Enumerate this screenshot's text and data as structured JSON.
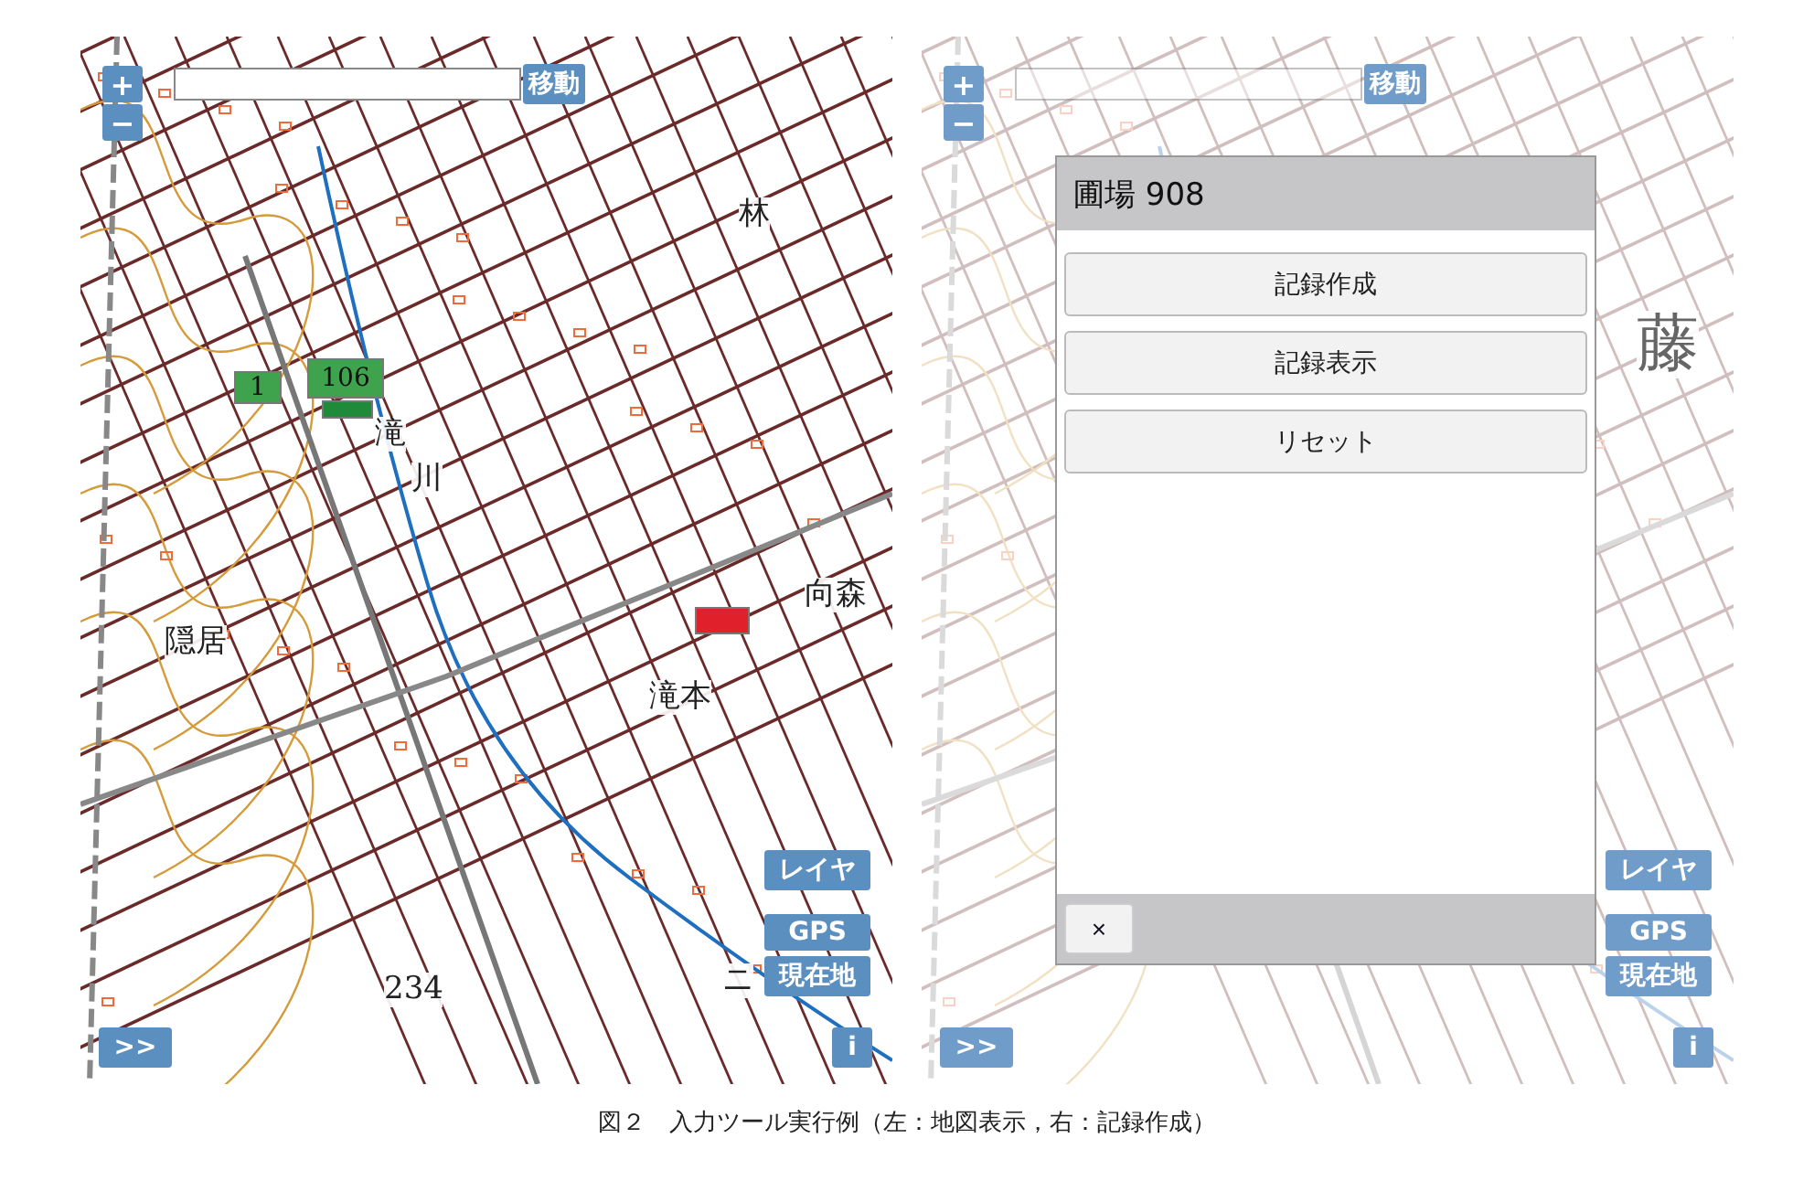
{
  "panels": [
    {
      "kind": "map",
      "faded": false,
      "zoom_in": "+",
      "zoom_out": "−",
      "move_button": "移動",
      "labels": [
        "林",
        "滝",
        "川",
        "隠居",
        "滝本",
        "向森",
        "234",
        "ニ"
      ],
      "parcels": [
        {
          "label": "1",
          "color": "#3fa34d"
        },
        {
          "label": "106",
          "color": "#3fa34d"
        },
        {
          "color": "#1f8a3a"
        },
        {
          "color": "#e0202a"
        }
      ],
      "layer_button": "レイヤ",
      "gps_button": "GPS",
      "location_button": "現在地",
      "expand_button": ">>",
      "info_button": "i"
    },
    {
      "kind": "map",
      "faded": true,
      "zoom_in": "+",
      "zoom_out": "−",
      "move_button": "移動",
      "labels": [
        "藤"
      ],
      "layer_button": "レイヤ",
      "gps_button": "GPS",
      "location_button": "現在地",
      "expand_button": ">>",
      "info_button": "i",
      "dialog": {
        "title": "圃場 908",
        "buttons": [
          "記録作成",
          "記録表示",
          "リセット"
        ],
        "close": "×"
      }
    }
  ],
  "caption": "図２　入力ツール実行例（左：地図表示，右：記録作成）"
}
